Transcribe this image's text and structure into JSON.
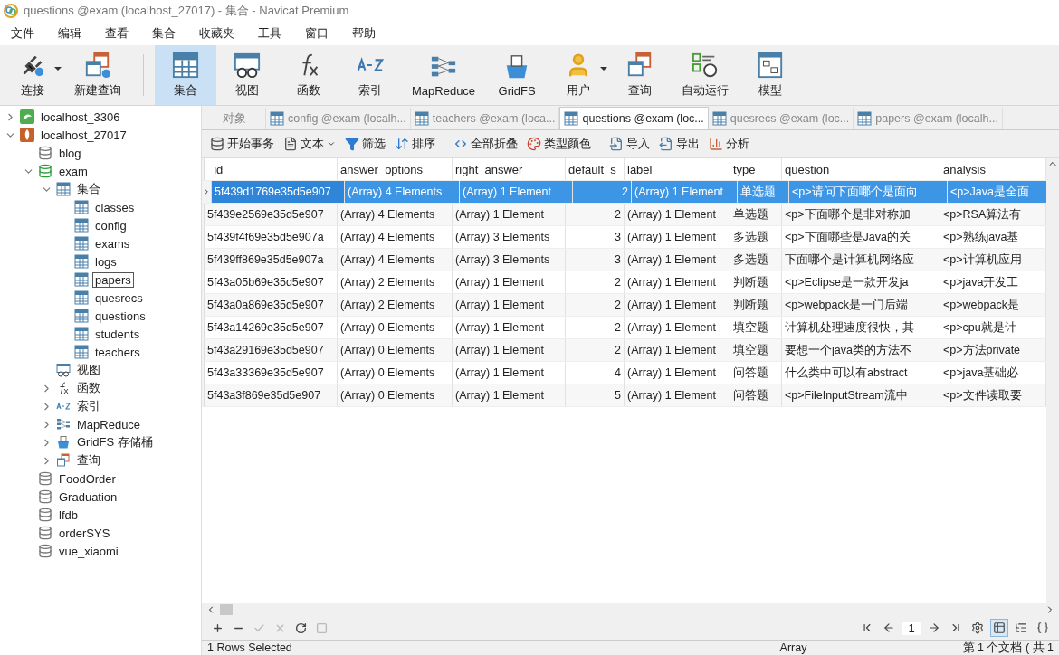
{
  "window": {
    "title": "questions @exam (localhost_27017) - 集合 - Navicat Premium"
  },
  "menu": [
    "文件",
    "编辑",
    "查看",
    "集合",
    "收藏夹",
    "工具",
    "窗口",
    "帮助"
  ],
  "toolbar": [
    {
      "kind": "plug",
      "label": "连接",
      "selected": false,
      "dropdown": true
    },
    {
      "kind": "newquery",
      "label": "新建查询",
      "selected": false,
      "dropdown": false
    },
    {
      "kind": "table",
      "label": "集合",
      "selected": true,
      "dropdown": false
    },
    {
      "kind": "view",
      "label": "视图",
      "selected": false,
      "dropdown": false
    },
    {
      "kind": "fx",
      "label": "函数",
      "selected": false,
      "dropdown": false
    },
    {
      "kind": "az",
      "label": "索引",
      "selected": false,
      "dropdown": false
    },
    {
      "kind": "mapreduce",
      "label": "MapReduce",
      "selected": false,
      "dropdown": false
    },
    {
      "kind": "gridfs",
      "label": "GridFS",
      "selected": false,
      "dropdown": false
    },
    {
      "kind": "user",
      "label": "用户",
      "selected": false,
      "dropdown": true
    },
    {
      "kind": "query",
      "label": "查询",
      "selected": false,
      "dropdown": false
    },
    {
      "kind": "auto",
      "label": "自动运行",
      "selected": false,
      "dropdown": false
    },
    {
      "kind": "model",
      "label": "模型",
      "selected": false,
      "dropdown": false
    }
  ],
  "sidebar": {
    "items": [
      {
        "kind": "mysql",
        "label": "localhost_3306",
        "expanded": false,
        "selected": false
      },
      {
        "kind": "mongo",
        "label": "localhost_27017",
        "expanded": true,
        "selected": false,
        "children": [
          {
            "kind": "db",
            "label": "blog",
            "selected": false
          },
          {
            "kind": "dbopen",
            "label": "exam",
            "expanded": true,
            "selected": false,
            "children": [
              {
                "kind": "table",
                "label": "集合",
                "expanded": true,
                "selected": false,
                "children": [
                  {
                    "kind": "table",
                    "label": "classes",
                    "selected": false
                  },
                  {
                    "kind": "table",
                    "label": "config",
                    "selected": false
                  },
                  {
                    "kind": "table",
                    "label": "exams",
                    "selected": false
                  },
                  {
                    "kind": "table",
                    "label": "logs",
                    "selected": false
                  },
                  {
                    "kind": "table",
                    "label": "papers",
                    "selected": true
                  },
                  {
                    "kind": "table",
                    "label": "quesrecs",
                    "selected": false
                  },
                  {
                    "kind": "table",
                    "label": "questions",
                    "selected": false
                  },
                  {
                    "kind": "table",
                    "label": "students",
                    "selected": false
                  },
                  {
                    "kind": "table",
                    "label": "teachers",
                    "selected": false
                  }
                ]
              },
              {
                "kind": "view",
                "label": "视图",
                "selected": false
              },
              {
                "kind": "fx",
                "label": "函数",
                "expanded": false,
                "selected": false
              },
              {
                "kind": "az",
                "label": "索引",
                "expanded": false,
                "selected": false
              },
              {
                "kind": "mapreduce",
                "label": "MapReduce",
                "expanded": false,
                "selected": false
              },
              {
                "kind": "gridfs",
                "label": "GridFS 存储桶",
                "expanded": false,
                "selected": false
              },
              {
                "kind": "query",
                "label": "查询",
                "expanded": false,
                "selected": false
              }
            ]
          },
          {
            "kind": "db",
            "label": "FoodOrder",
            "selected": false
          },
          {
            "kind": "db",
            "label": "Graduation",
            "selected": false
          },
          {
            "kind": "db",
            "label": "lfdb",
            "selected": false
          },
          {
            "kind": "db",
            "label": "orderSYS",
            "selected": false
          },
          {
            "kind": "db",
            "label": "vue_xiaomi",
            "selected": false
          }
        ]
      }
    ]
  },
  "tabs": [
    {
      "kind": "objects",
      "label": "对象",
      "selected": false
    },
    {
      "kind": "table",
      "label": "config @exam (localh...",
      "selected": false
    },
    {
      "kind": "table",
      "label": "teachers @exam (loca...",
      "selected": false
    },
    {
      "kind": "table",
      "label": "questions @exam (loc...",
      "selected": true
    },
    {
      "kind": "table",
      "label": "quesrecs @exam (loc...",
      "selected": false
    },
    {
      "kind": "table",
      "label": "papers @exam (localh...",
      "selected": false
    }
  ],
  "actions": [
    {
      "kind": "tx",
      "label": "开始事务",
      "dropdown": false
    },
    {
      "kind": "text",
      "label": "文本",
      "dropdown": true
    },
    {
      "kind": "filter",
      "label": "筛选",
      "dropdown": false
    },
    {
      "kind": "sort",
      "label": "排序",
      "dropdown": false
    },
    {
      "kind": "collapse",
      "label": "全部折叠",
      "dropdown": false
    },
    {
      "kind": "color",
      "label": "类型颜色",
      "dropdown": false
    },
    {
      "kind": "import",
      "label": "导入",
      "dropdown": false
    },
    {
      "kind": "export",
      "label": "导出",
      "dropdown": false
    },
    {
      "kind": "chart",
      "label": "分析",
      "dropdown": false
    }
  ],
  "table": {
    "columns": [
      {
        "label": "_id",
        "kind": "text"
      },
      {
        "label": "answer_options",
        "kind": "text"
      },
      {
        "label": "right_answer",
        "kind": "text"
      },
      {
        "label": "default_s",
        "kind": "number"
      },
      {
        "label": "label",
        "kind": "text"
      },
      {
        "label": "type",
        "kind": "text"
      },
      {
        "label": "question",
        "kind": "text"
      },
      {
        "label": "analysis",
        "kind": "text"
      }
    ],
    "rows": [
      {
        "selected": true,
        "cells": [
          "5f439d1769e35d5e907",
          "(Array) 4 Elements",
          "(Array) 1 Element",
          "2",
          "(Array) 1 Element",
          "单选题",
          "<p>请问下面哪个是面向",
          "<p>Java是全面"
        ]
      },
      {
        "selected": false,
        "cells": [
          "5f439e2569e35d5e907",
          "(Array) 4 Elements",
          "(Array) 1 Element",
          "2",
          "(Array) 1 Element",
          "单选题",
          "<p>下面哪个是非对称加",
          "<p>RSA算法有"
        ]
      },
      {
        "selected": false,
        "cells": [
          "5f439f4f69e35d5e907a",
          "(Array) 4 Elements",
          "(Array) 3 Elements",
          "3",
          "(Array) 1 Element",
          "多选题",
          "<p>下面哪些是Java的关",
          "<p>熟练java基"
        ]
      },
      {
        "selected": false,
        "cells": [
          "5f439ff869e35d5e907a",
          "(Array) 4 Elements",
          "(Array) 3 Elements",
          "3",
          "(Array) 1 Element",
          "多选题",
          "下面哪个是计算机网络应",
          "<p>计算机应用"
        ]
      },
      {
        "selected": false,
        "cells": [
          "5f43a05b69e35d5e907",
          "(Array) 2 Elements",
          "(Array) 1 Element",
          "2",
          "(Array) 1 Element",
          "判断题",
          "<p>Eclipse是一款开发ja",
          "<p>java开发工"
        ]
      },
      {
        "selected": false,
        "cells": [
          "5f43a0a869e35d5e907",
          "(Array) 2 Elements",
          "(Array) 1 Element",
          "2",
          "(Array) 1 Element",
          "判断题",
          "<p>webpack是一门后端",
          "<p>webpack是"
        ]
      },
      {
        "selected": false,
        "cells": [
          "5f43a14269e35d5e907",
          "(Array) 0 Elements",
          "(Array) 1 Element",
          "2",
          "(Array) 1 Element",
          "填空题",
          "计算机处理速度很快，其",
          "<p>cpu就是计"
        ]
      },
      {
        "selected": false,
        "cells": [
          "5f43a29169e35d5e907",
          "(Array) 0 Elements",
          "(Array) 1 Element",
          "2",
          "(Array) 1 Element",
          "填空题",
          "要想一个java类的方法不",
          "<p>方法private"
        ]
      },
      {
        "selected": false,
        "cells": [
          "5f43a33369e35d5e907",
          "(Array) 0 Elements",
          "(Array) 1 Element",
          "4",
          "(Array) 1 Element",
          "问答题",
          "什么类中可以有abstract",
          "<p>java基础必"
        ]
      },
      {
        "selected": false,
        "cells": [
          "5f43a3f869e35d5e907",
          "(Array) 0 Elements",
          "(Array) 1 Element",
          "5",
          "(Array) 1 Element",
          "问答题",
          "<p>FileInputStream流中",
          "<p>文件读取要"
        ]
      }
    ]
  },
  "pager": {
    "page": "1"
  },
  "record_tools": [
    {
      "kind": "add",
      "disabled": false
    },
    {
      "kind": "remove",
      "disabled": false
    },
    {
      "kind": "apply",
      "disabled": true
    },
    {
      "kind": "discard",
      "disabled": true
    },
    {
      "kind": "refresh",
      "disabled": false
    },
    {
      "kind": "stop",
      "disabled": true
    }
  ],
  "view_modes": [
    {
      "kind": "grid",
      "selected": true
    },
    {
      "kind": "tree",
      "selected": false
    },
    {
      "kind": "json",
      "selected": false
    }
  ],
  "status_bar": {
    "selection": "1 Rows Selected",
    "type": "Array",
    "position": "第 1 个文档 ( 共 1"
  }
}
